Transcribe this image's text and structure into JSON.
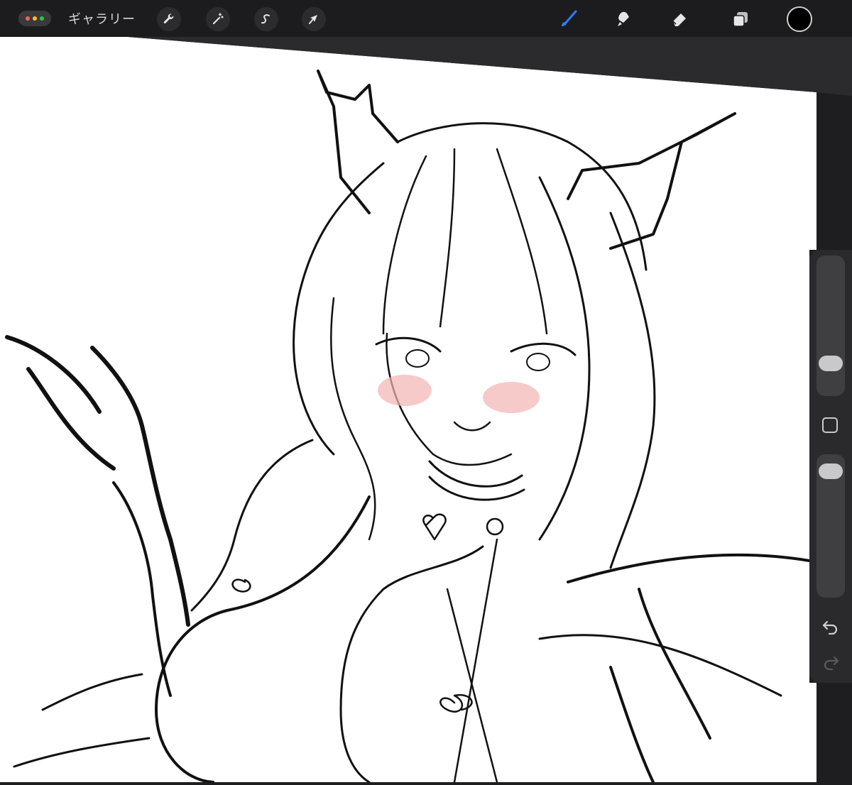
{
  "toolbar": {
    "gallery_label": "ギャラリー",
    "window_dots": [
      "#ff5f57",
      "#febc2e",
      "#28c840"
    ],
    "left_tools": [
      {
        "name": "actions",
        "icon": "wrench-icon"
      },
      {
        "name": "adjustments",
        "icon": "magic-wand-icon"
      },
      {
        "name": "selection",
        "icon": "selection-s-icon"
      },
      {
        "name": "transform",
        "icon": "arrow-cursor-icon"
      }
    ],
    "right_tools": [
      {
        "name": "brush",
        "icon": "brush-icon",
        "active": true
      },
      {
        "name": "smudge",
        "icon": "smudge-icon",
        "active": false
      },
      {
        "name": "eraser",
        "icon": "eraser-icon",
        "active": false
      },
      {
        "name": "layers",
        "icon": "layers-icon",
        "active": false
      }
    ],
    "active_color": "#000000",
    "accent_color": "#2f7cf6"
  },
  "sidebar": {
    "brush_size_level": 0.19,
    "opacity_level": 0.94,
    "icons": [
      "modify-square-icon",
      "undo-icon",
      "redo-icon"
    ]
  },
  "canvas": {
    "background": "#ffffff",
    "content": "line-art-sketch"
  }
}
